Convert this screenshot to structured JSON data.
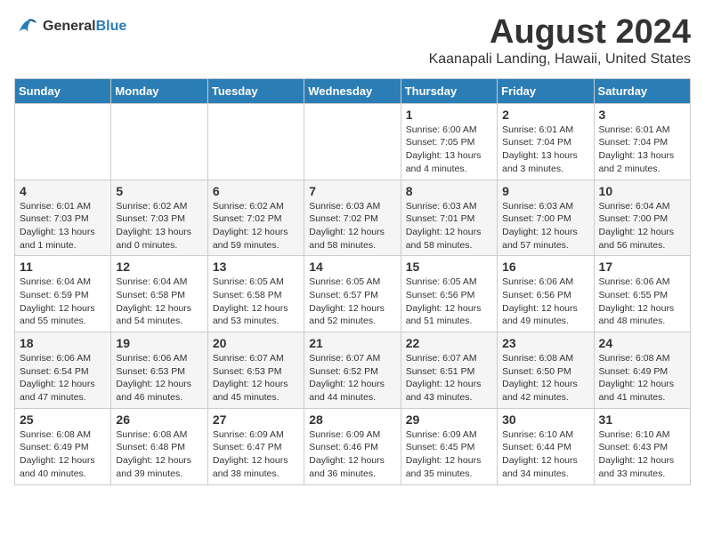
{
  "logo": {
    "line1": "General",
    "line2": "Blue"
  },
  "title": "August 2024",
  "subtitle": "Kaanapali Landing, Hawaii, United States",
  "headers": [
    "Sunday",
    "Monday",
    "Tuesday",
    "Wednesday",
    "Thursday",
    "Friday",
    "Saturday"
  ],
  "weeks": [
    [
      {
        "day": "",
        "detail": ""
      },
      {
        "day": "",
        "detail": ""
      },
      {
        "day": "",
        "detail": ""
      },
      {
        "day": "",
        "detail": ""
      },
      {
        "day": "1",
        "detail": "Sunrise: 6:00 AM\nSunset: 7:05 PM\nDaylight: 13 hours\nand 4 minutes."
      },
      {
        "day": "2",
        "detail": "Sunrise: 6:01 AM\nSunset: 7:04 PM\nDaylight: 13 hours\nand 3 minutes."
      },
      {
        "day": "3",
        "detail": "Sunrise: 6:01 AM\nSunset: 7:04 PM\nDaylight: 13 hours\nand 2 minutes."
      }
    ],
    [
      {
        "day": "4",
        "detail": "Sunrise: 6:01 AM\nSunset: 7:03 PM\nDaylight: 13 hours\nand 1 minute."
      },
      {
        "day": "5",
        "detail": "Sunrise: 6:02 AM\nSunset: 7:03 PM\nDaylight: 13 hours\nand 0 minutes."
      },
      {
        "day": "6",
        "detail": "Sunrise: 6:02 AM\nSunset: 7:02 PM\nDaylight: 12 hours\nand 59 minutes."
      },
      {
        "day": "7",
        "detail": "Sunrise: 6:03 AM\nSunset: 7:02 PM\nDaylight: 12 hours\nand 58 minutes."
      },
      {
        "day": "8",
        "detail": "Sunrise: 6:03 AM\nSunset: 7:01 PM\nDaylight: 12 hours\nand 58 minutes."
      },
      {
        "day": "9",
        "detail": "Sunrise: 6:03 AM\nSunset: 7:00 PM\nDaylight: 12 hours\nand 57 minutes."
      },
      {
        "day": "10",
        "detail": "Sunrise: 6:04 AM\nSunset: 7:00 PM\nDaylight: 12 hours\nand 56 minutes."
      }
    ],
    [
      {
        "day": "11",
        "detail": "Sunrise: 6:04 AM\nSunset: 6:59 PM\nDaylight: 12 hours\nand 55 minutes."
      },
      {
        "day": "12",
        "detail": "Sunrise: 6:04 AM\nSunset: 6:58 PM\nDaylight: 12 hours\nand 54 minutes."
      },
      {
        "day": "13",
        "detail": "Sunrise: 6:05 AM\nSunset: 6:58 PM\nDaylight: 12 hours\nand 53 minutes."
      },
      {
        "day": "14",
        "detail": "Sunrise: 6:05 AM\nSunset: 6:57 PM\nDaylight: 12 hours\nand 52 minutes."
      },
      {
        "day": "15",
        "detail": "Sunrise: 6:05 AM\nSunset: 6:56 PM\nDaylight: 12 hours\nand 51 minutes."
      },
      {
        "day": "16",
        "detail": "Sunrise: 6:06 AM\nSunset: 6:56 PM\nDaylight: 12 hours\nand 49 minutes."
      },
      {
        "day": "17",
        "detail": "Sunrise: 6:06 AM\nSunset: 6:55 PM\nDaylight: 12 hours\nand 48 minutes."
      }
    ],
    [
      {
        "day": "18",
        "detail": "Sunrise: 6:06 AM\nSunset: 6:54 PM\nDaylight: 12 hours\nand 47 minutes."
      },
      {
        "day": "19",
        "detail": "Sunrise: 6:06 AM\nSunset: 6:53 PM\nDaylight: 12 hours\nand 46 minutes."
      },
      {
        "day": "20",
        "detail": "Sunrise: 6:07 AM\nSunset: 6:53 PM\nDaylight: 12 hours\nand 45 minutes."
      },
      {
        "day": "21",
        "detail": "Sunrise: 6:07 AM\nSunset: 6:52 PM\nDaylight: 12 hours\nand 44 minutes."
      },
      {
        "day": "22",
        "detail": "Sunrise: 6:07 AM\nSunset: 6:51 PM\nDaylight: 12 hours\nand 43 minutes."
      },
      {
        "day": "23",
        "detail": "Sunrise: 6:08 AM\nSunset: 6:50 PM\nDaylight: 12 hours\nand 42 minutes."
      },
      {
        "day": "24",
        "detail": "Sunrise: 6:08 AM\nSunset: 6:49 PM\nDaylight: 12 hours\nand 41 minutes."
      }
    ],
    [
      {
        "day": "25",
        "detail": "Sunrise: 6:08 AM\nSunset: 6:49 PM\nDaylight: 12 hours\nand 40 minutes."
      },
      {
        "day": "26",
        "detail": "Sunrise: 6:08 AM\nSunset: 6:48 PM\nDaylight: 12 hours\nand 39 minutes."
      },
      {
        "day": "27",
        "detail": "Sunrise: 6:09 AM\nSunset: 6:47 PM\nDaylight: 12 hours\nand 38 minutes."
      },
      {
        "day": "28",
        "detail": "Sunrise: 6:09 AM\nSunset: 6:46 PM\nDaylight: 12 hours\nand 36 minutes."
      },
      {
        "day": "29",
        "detail": "Sunrise: 6:09 AM\nSunset: 6:45 PM\nDaylight: 12 hours\nand 35 minutes."
      },
      {
        "day": "30",
        "detail": "Sunrise: 6:10 AM\nSunset: 6:44 PM\nDaylight: 12 hours\nand 34 minutes."
      },
      {
        "day": "31",
        "detail": "Sunrise: 6:10 AM\nSunset: 6:43 PM\nDaylight: 12 hours\nand 33 minutes."
      }
    ]
  ]
}
